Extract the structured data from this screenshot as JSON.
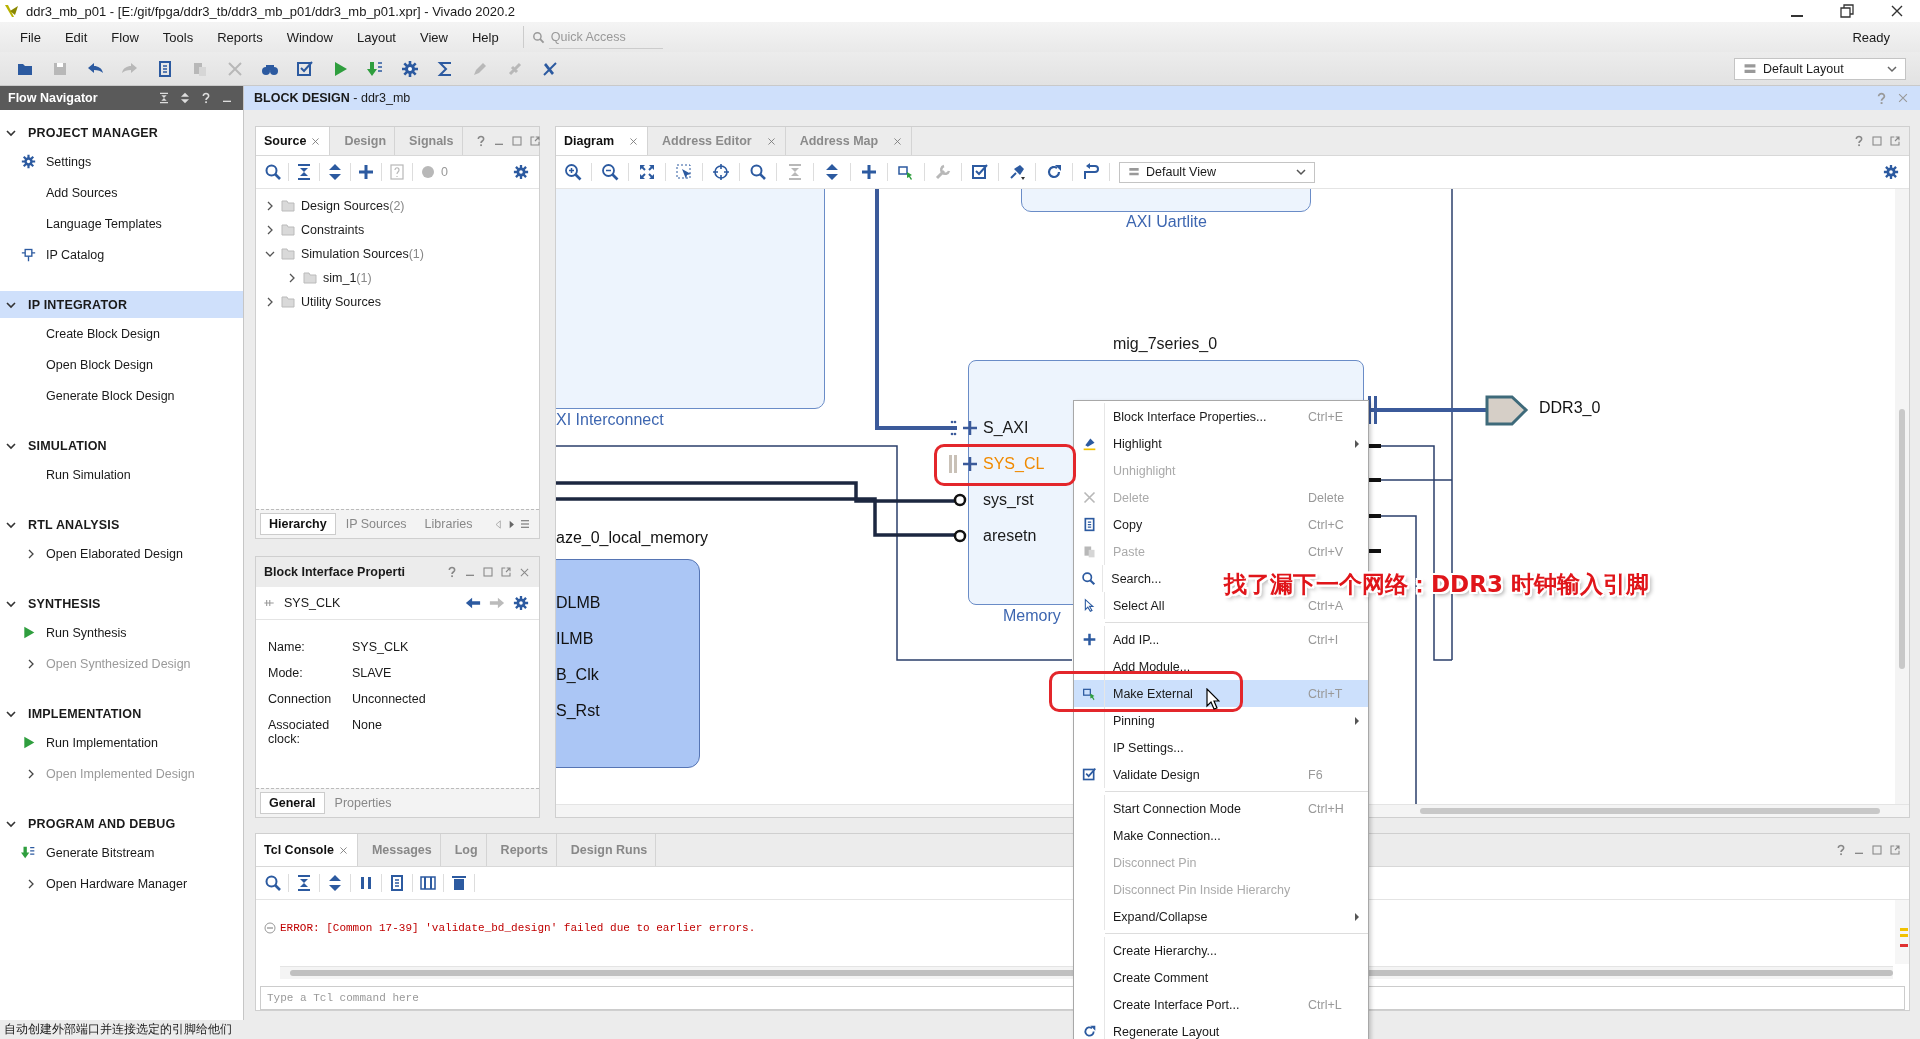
{
  "window": {
    "title": "ddr3_mb_p01 - [E:/git/fpga/ddr3_tb/ddr3_mb_p01/ddr3_mb_p01.xpr] - Vivado 2020.2"
  },
  "menu_bar": [
    "File",
    "Edit",
    "Flow",
    "Tools",
    "Reports",
    "Window",
    "Layout",
    "View",
    "Help"
  ],
  "quick_access": {
    "placeholder": "Quick Access"
  },
  "status": "Ready",
  "toolbar": [
    {
      "disabled": false
    },
    {
      "disabled": true
    },
    {
      "disabled": false
    },
    {
      "disabled": true
    },
    {
      "disabled": false
    },
    {
      "disabled": true
    },
    {
      "disabled": true
    },
    {
      "disabled": false
    },
    {
      "disabled": false
    },
    {
      "disabled": false
    },
    {
      "disabled": false
    },
    {
      "disabled": false
    },
    {
      "disabled": false
    },
    {
      "disabled": true
    },
    {
      "disabled": true
    },
    {
      "disabled": false
    }
  ],
  "layout_select": {
    "value": "Default Layout"
  },
  "flow_navigator": {
    "title": "Flow Navigator",
    "sections": [
      {
        "title": "PROJECT MANAGER",
        "expanded": true,
        "selected": false,
        "items": [
          {
            "label": "Settings",
            "kind": "settings",
            "disabled": false
          },
          {
            "label": "Add Sources",
            "kind": "plain",
            "disabled": false
          },
          {
            "label": "Language Templates",
            "kind": "plain",
            "disabled": false
          },
          {
            "label": "IP Catalog",
            "kind": "catalog",
            "disabled": false
          }
        ]
      },
      {
        "title": "IP INTEGRATOR",
        "expanded": true,
        "selected": true,
        "items": [
          {
            "label": "Create Block Design",
            "kind": "plain",
            "disabled": false
          },
          {
            "label": "Open Block Design",
            "kind": "plain",
            "disabled": false
          },
          {
            "label": "Generate Block Design",
            "kind": "plain",
            "disabled": false
          }
        ]
      },
      {
        "title": "SIMULATION",
        "expanded": true,
        "selected": false,
        "items": [
          {
            "label": "Run Simulation",
            "kind": "plain",
            "disabled": false
          }
        ]
      },
      {
        "title": "RTL ANALYSIS",
        "expanded": true,
        "selected": false,
        "items": [
          {
            "label": "Open Elaborated Design",
            "kind": "expandable",
            "disabled": false
          }
        ]
      },
      {
        "title": "SYNTHESIS",
        "expanded": true,
        "selected": false,
        "items": [
          {
            "label": "Run Synthesis",
            "kind": "run",
            "disabled": false
          },
          {
            "label": "Open Synthesized Design",
            "kind": "expandable",
            "disabled": true
          }
        ]
      },
      {
        "title": "IMPLEMENTATION",
        "expanded": true,
        "selected": false,
        "items": [
          {
            "label": "Run Implementation",
            "kind": "run",
            "disabled": false
          },
          {
            "label": "Open Implemented Design",
            "kind": "expandable",
            "disabled": true
          }
        ]
      },
      {
        "title": "PROGRAM AND DEBUG",
        "expanded": true,
        "selected": false,
        "items": [
          {
            "label": "Generate Bitstream",
            "kind": "bitstream",
            "disabled": false
          },
          {
            "label": "Open Hardware Manager",
            "kind": "expandable",
            "disabled": false
          }
        ]
      }
    ]
  },
  "block_design": {
    "title": "**BLOCK DESIGN** - ddr3_mb"
  },
  "sources": {
    "tabs": [
      {
        "label": "Source",
        "selected": true
      },
      {
        "label": "Design",
        "selected": false
      },
      {
        "label": "Signals",
        "selected": false
      }
    ],
    "toolbar": [
      {
        "disabled": false
      },
      {
        "disabled": false
      },
      {
        "disabled": false
      },
      {
        "disabled": false
      },
      {
        "disabled": true
      },
      {
        "disabled": true
      }
    ],
    "count": "0",
    "tree": [
      {
        "label": "Design Sources",
        "count": "(2)",
        "expanded": false
      },
      {
        "label": "Constraints",
        "expanded": false
      },
      {
        "label": "Simulation Sources",
        "count": "(1)",
        "expanded": true,
        "children": [
          {
            "label": "sim_1",
            "count": "(1)",
            "expanded": false
          }
        ]
      },
      {
        "label": "Utility Sources",
        "expanded": false
      }
    ],
    "bottom_tabs": [
      {
        "label": "Hierarchy",
        "selected": true
      },
      {
        "label": "IP Sources",
        "selected": false
      },
      {
        "label": "Libraries",
        "selected": false
      }
    ]
  },
  "properties": {
    "title": "Block Interface Properti",
    "object": "SYS_CLK",
    "rows": [
      {
        "label": "Name:",
        "value": "SYS_CLK"
      },
      {
        "label": "Mode:",
        "value": "SLAVE"
      },
      {
        "label": "Connection",
        "value": "Unconnected"
      },
      {
        "label": "Associated clock:",
        "value": "None"
      }
    ],
    "tabs": [
      {
        "label": "General",
        "selected": true
      },
      {
        "label": "Properties",
        "selected": false
      }
    ]
  },
  "diagram": {
    "tabs": [
      {
        "label": "Diagram",
        "selected": true
      },
      {
        "label": "Address Editor",
        "selected": false
      },
      {
        "label": "Address Map",
        "selected": false
      }
    ],
    "toolbar": [
      {
        "disabled": false
      },
      {
        "disabled": false
      },
      {
        "disabled": false
      },
      {
        "disabled": false
      },
      {
        "disabled": false
      },
      {
        "disabled": false
      },
      {
        "disabled": true
      },
      {
        "disabled": false
      },
      {
        "disabled": false
      },
      {
        "disabled": false
      },
      {
        "disabled": true
      },
      {
        "disabled": false
      },
      {
        "disabled": false
      },
      {
        "disabled": false
      },
      {
        "disabled": false
      }
    ],
    "view": "Default View",
    "interconnect": {
      "label": "XI Interconnect"
    },
    "uartlite": {
      "label": "AXI Uartlite"
    },
    "mig": {
      "name": "mig_7series_0",
      "label": "Memory",
      "pins": [
        {
          "name": "S_AXI",
          "kind": "bus",
          "selected": false
        },
        {
          "name": "SYS_CL",
          "kind": "bus",
          "selected": true
        },
        {
          "name": "sys_rst",
          "kind": "wire",
          "selected": false
        },
        {
          "name": "aresetn",
          "kind": "wire",
          "selected": false
        }
      ]
    },
    "port": {
      "name": "DDR3_0"
    },
    "local_memory": {
      "name": "aze_0_local_memory",
      "pins": [
        "DLMB",
        "ILMB",
        "B_Clk",
        "S_Rst"
      ]
    }
  },
  "context_menu": [
    [
      {
        "label": "Block Interface Properties...",
        "shortcut": "Ctrl+E",
        "disabled": false,
        "submenu": false,
        "selected": false
      },
      {
        "label": "Highlight",
        "disabled": false,
        "submenu": true,
        "selected": false
      },
      {
        "label": "Unhighlight",
        "disabled": true,
        "submenu": false,
        "selected": false
      },
      {
        "label": "Delete",
        "shortcut": "Delete",
        "disabled": true,
        "submenu": false,
        "selected": false
      },
      {
        "label": "Copy",
        "shortcut": "Ctrl+C",
        "disabled": false,
        "submenu": false,
        "selected": false
      },
      {
        "label": "Paste",
        "shortcut": "Ctrl+V",
        "disabled": true,
        "submenu": false,
        "selected": false
      },
      {
        "label": "Search...",
        "disabled": false,
        "submenu": false,
        "selected": false
      },
      {
        "label": "Select All",
        "shortcut": "Ctrl+A",
        "disabled": false,
        "submenu": false,
        "selected": false
      }
    ],
    [
      {
        "label": "Add IP...",
        "shortcut": "Ctrl+I",
        "disabled": false,
        "submenu": false,
        "selected": false
      },
      {
        "label": "Add Module...",
        "disabled": false,
        "submenu": false,
        "selected": false
      },
      {
        "label": "Make External",
        "shortcut": "Ctrl+T",
        "disabled": false,
        "submenu": false,
        "selected": true
      },
      {
        "label": "Pinning",
        "disabled": false,
        "submenu": true,
        "selected": false
      },
      {
        "label": "IP Settings...",
        "disabled": false,
        "submenu": false,
        "selected": false
      },
      {
        "label": "Validate Design",
        "shortcut": "F6",
        "disabled": false,
        "submenu": false,
        "selected": false
      }
    ],
    [
      {
        "label": "Start Connection Mode",
        "shortcut": "Ctrl+H",
        "disabled": false,
        "submenu": false,
        "selected": false
      },
      {
        "label": "Make Connection...",
        "disabled": false,
        "submenu": false,
        "selected": false
      },
      {
        "label": "Disconnect Pin",
        "disabled": true,
        "submenu": false,
        "selected": false
      },
      {
        "label": "Disconnect Pin Inside Hierarchy",
        "disabled": true,
        "submenu": false,
        "selected": false
      },
      {
        "label": "Expand/Collapse",
        "disabled": false,
        "submenu": true,
        "selected": false
      }
    ],
    [
      {
        "label": "Create Hierarchy...",
        "disabled": false,
        "submenu": false,
        "selected": false
      },
      {
        "label": "Create Comment",
        "disabled": false,
        "submenu": false,
        "selected": false
      },
      {
        "label": "Create Interface Port...",
        "shortcut": "Ctrl+L",
        "disabled": false,
        "submenu": false,
        "selected": false
      },
      {
        "label": "Regenerate Layout",
        "disabled": false,
        "submenu": false,
        "selected": false
      }
    ]
  ],
  "annotation": "找了漏下一个网络：DDR3 时钟输入引脚",
  "console": {
    "tabs": [
      {
        "label": "Tcl Console",
        "selected": true
      },
      {
        "label": "Messages",
        "selected": false
      },
      {
        "label": "Log",
        "selected": false
      },
      {
        "label": "Reports",
        "selected": false
      },
      {
        "label": "Design Runs",
        "selected": false
      }
    ],
    "lines": [
      {
        "text": "ERROR: [Common 17-39] 'validate_bd_design' failed due to earlier errors.",
        "kind": "error"
      }
    ],
    "placeholder": "Type a Tcl command here"
  },
  "status_bar": "自动创建外部端口并连接选定的引脚给他们"
}
